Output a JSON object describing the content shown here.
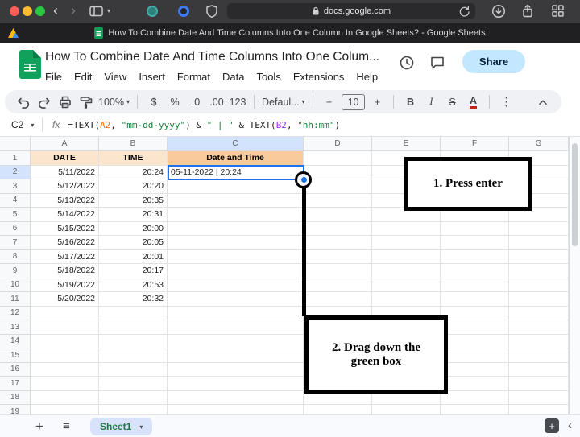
{
  "browser": {
    "url": "docs.google.com",
    "tab_title": "How To Combine Date And Time Columns Into One Column In Google Sheets? - Google Sheets"
  },
  "app": {
    "title": "How To Combine Date And Time Columns Into One Colum...",
    "menus": [
      "File",
      "Edit",
      "View",
      "Insert",
      "Format",
      "Data",
      "Tools",
      "Extensions",
      "Help"
    ],
    "share": "Share"
  },
  "toolbar": {
    "zoom": "100%",
    "currency": "$",
    "percent": "%",
    "decimal_decrease": ".0",
    "decimal_increase": ".00",
    "more_formats": "123",
    "font_family": "Defaul...",
    "font_size": "10",
    "minus": "−",
    "plus": "+",
    "bold": "B",
    "italic": "I",
    "strikethrough": "S",
    "text_color": "A",
    "more": "⋮"
  },
  "formula_bar": {
    "cell_ref": "C2",
    "fx": "fx",
    "tokens": [
      {
        "text": "=TEXT(",
        "color": "#202124"
      },
      {
        "text": "A2",
        "color": "#e8710a"
      },
      {
        "text": ", ",
        "color": "#202124"
      },
      {
        "text": "\"mm-dd-yyyy\"",
        "color": "#188038"
      },
      {
        "text": ") & ",
        "color": "#202124"
      },
      {
        "text": "\" | \"",
        "color": "#188038"
      },
      {
        "text": " & TEXT(",
        "color": "#202124"
      },
      {
        "text": "B2",
        "color": "#9334e6"
      },
      {
        "text": ", ",
        "color": "#202124"
      },
      {
        "text": "\"hh:mm\"",
        "color": "#188038"
      },
      {
        "text": ")",
        "color": "#202124"
      }
    ]
  },
  "grid": {
    "column_letters": [
      "A",
      "B",
      "C",
      "D",
      "E",
      "F",
      "G"
    ],
    "selected_column": "C",
    "selected_row": 2,
    "header_row": {
      "a": "DATE",
      "b": "TIME",
      "c": "Date and Time"
    },
    "data_rows": [
      {
        "a": "5/11/2022",
        "b": "20:24",
        "c": "05-11-2022 | 20:24"
      },
      {
        "a": "5/12/2022",
        "b": "20:20",
        "c": ""
      },
      {
        "a": "5/13/2022",
        "b": "20:35",
        "c": ""
      },
      {
        "a": "5/14/2022",
        "b": "20:31",
        "c": ""
      },
      {
        "a": "5/15/2022",
        "b": "20:00",
        "c": ""
      },
      {
        "a": "5/16/2022",
        "b": "20:05",
        "c": ""
      },
      {
        "a": "5/17/2022",
        "b": "20:01",
        "c": ""
      },
      {
        "a": "5/18/2022",
        "b": "20:17",
        "c": ""
      },
      {
        "a": "5/19/2022",
        "b": "20:53",
        "c": ""
      },
      {
        "a": "5/20/2022",
        "b": "20:32",
        "c": ""
      }
    ],
    "total_rows": 19
  },
  "annotations": {
    "step1": "1. Press enter",
    "step2": "2. Drag down the green box"
  },
  "sheet_bar": {
    "add": "+",
    "all_sheets": "≡",
    "sheet_name": "Sheet1"
  },
  "colors": {
    "accent_blue": "#1a73e8",
    "header_fill_light": "#fce5cd",
    "header_fill_dark": "#f9cb9c",
    "share_bg": "#c2e7ff",
    "sheets_green": "#0f9d58"
  }
}
